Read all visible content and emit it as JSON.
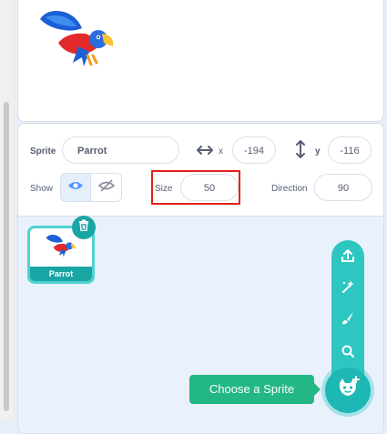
{
  "sprite_info": {
    "sprite_label": "Sprite",
    "sprite_name": "Parrot",
    "x_label": "x",
    "x_value": "-194",
    "y_label": "y",
    "y_value": "-116",
    "show_label": "Show",
    "size_label": "Size",
    "size_value": "50",
    "direction_label": "Direction",
    "direction_value": "90"
  },
  "sprite_list": {
    "items": [
      {
        "name": "Parrot",
        "selected": true
      }
    ]
  },
  "sprite_menu": {
    "tooltip": "Choose a Sprite",
    "options": [
      "upload-icon",
      "surprise-icon",
      "paint-icon",
      "search-icon"
    ]
  },
  "colors": {
    "accent": "#2ec6c1",
    "selected": "#4fd3d3",
    "tooltip": "#23b883",
    "highlight": "#e0241b"
  }
}
